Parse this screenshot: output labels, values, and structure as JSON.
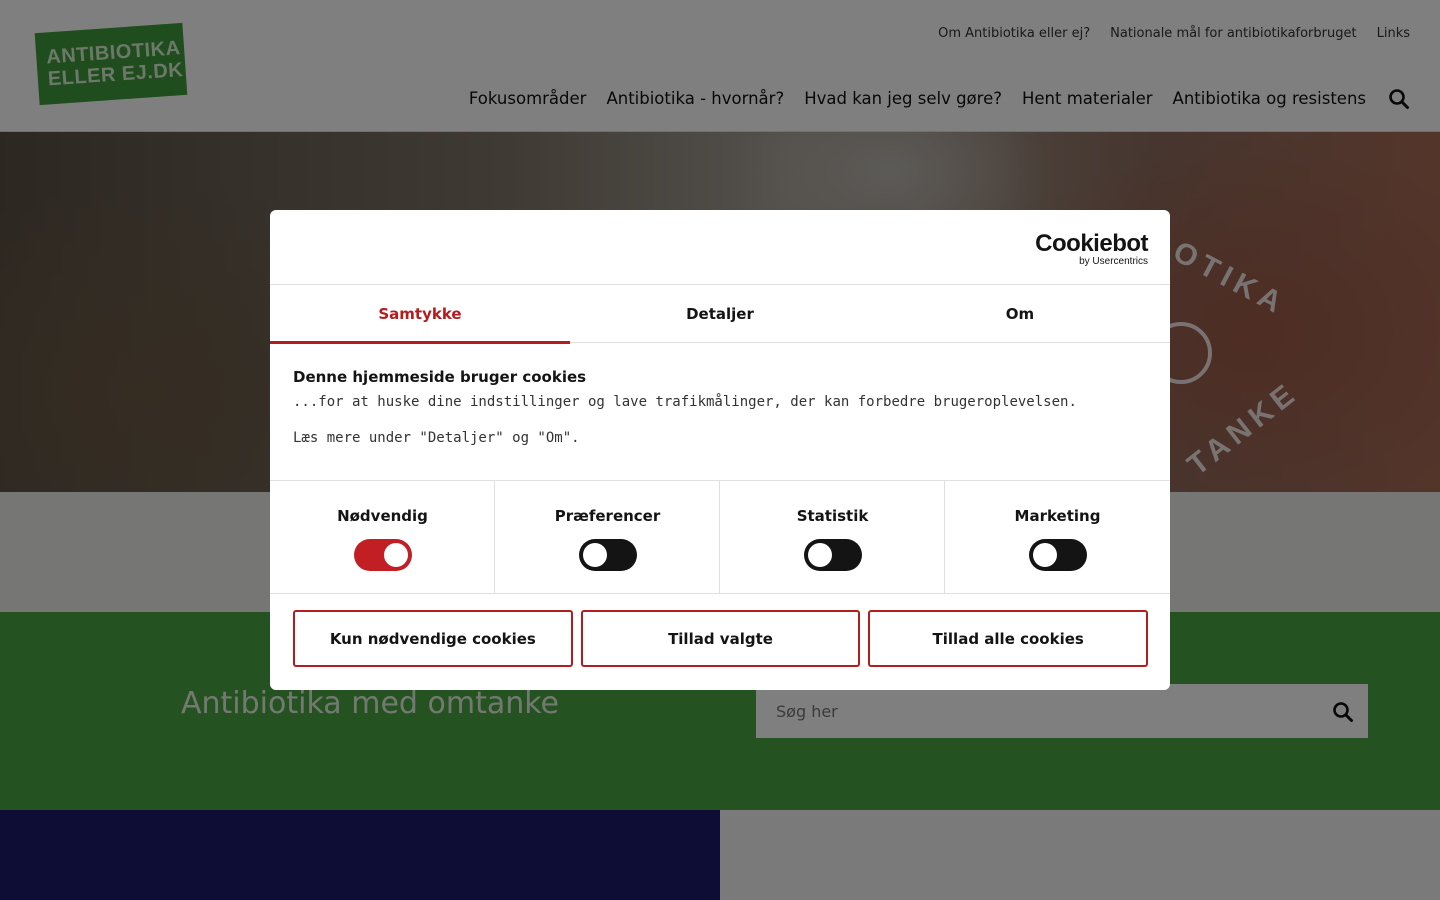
{
  "header": {
    "logo_line1": "ANTIBIOTIKA",
    "logo_line2": "ELLER EJ.DK",
    "top_links": [
      "Om Antibiotika eller ej?",
      "Nationale mål for antibiotikaforbruget",
      "Links"
    ],
    "main_nav": [
      "Fokusområder",
      "Antibiotika - hvornår?",
      "Hvad kan jeg selv gøre?",
      "Hent materialer",
      "Antibiotika og resistens"
    ],
    "search_icon": "search-icon"
  },
  "hero": {
    "badge_text_top": "OTIKA",
    "badge_text_bottom": "TANKE"
  },
  "band": {
    "title": "Antibiotika med omtanke",
    "search_placeholder": "Søg her",
    "search_icon": "search-icon"
  },
  "dialog": {
    "brand": "Cookiebot",
    "brand_sub": "by Usercentrics",
    "tabs": [
      "Samtykke",
      "Detaljer",
      "Om"
    ],
    "active_tab": "Samtykke",
    "title": "Denne hjemmeside bruger cookies",
    "text1": "...for at huske dine indstillinger og lave trafikmålinger, der kan forbedre brugeroplevelsen.",
    "text2": "Læs mere under \"Detaljer\" og \"Om\".",
    "categories": [
      {
        "label": "Nødvendig",
        "enabled": true
      },
      {
        "label": "Præferencer",
        "enabled": false
      },
      {
        "label": "Statistik",
        "enabled": false
      },
      {
        "label": "Marketing",
        "enabled": false
      }
    ],
    "buttons": [
      "Kun nødvendige cookies",
      "Tillad valgte",
      "Tillad alle cookies"
    ]
  },
  "colors": {
    "accent_red": "#b31d1d",
    "green": "#4aa442",
    "navy": "#1c1a6b"
  }
}
